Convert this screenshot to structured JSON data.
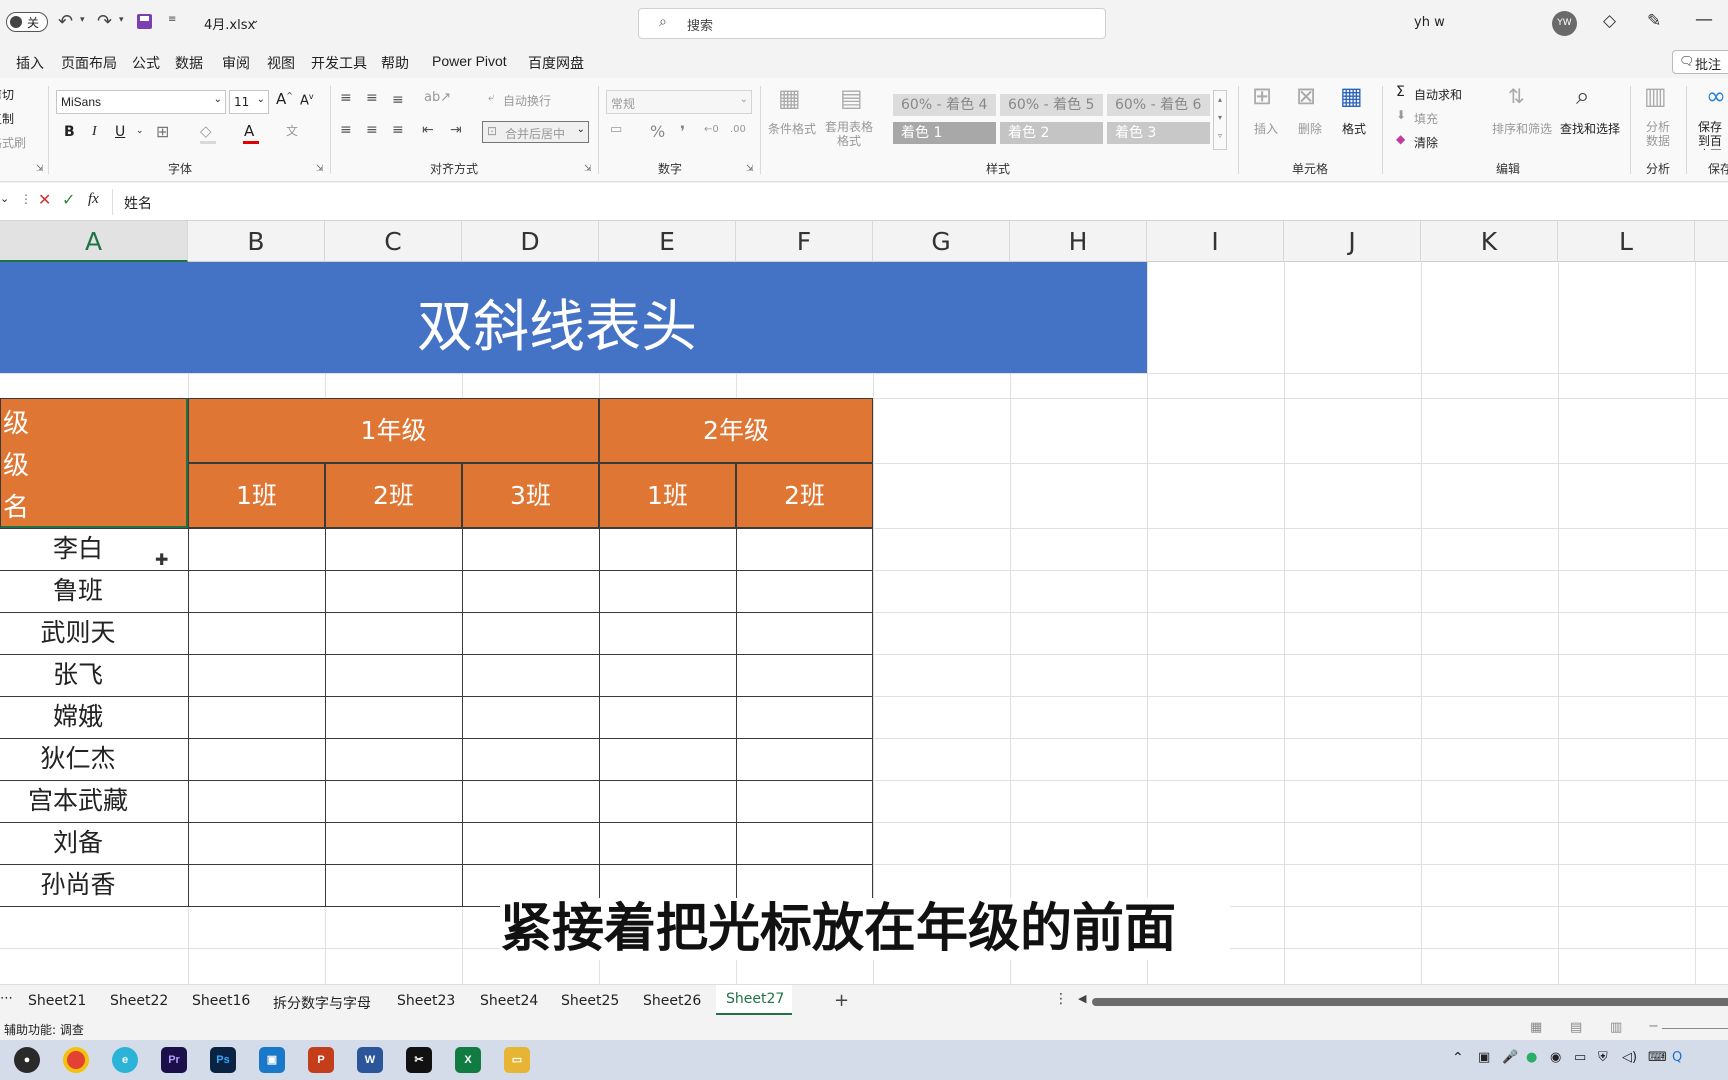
{
  "titlebar": {
    "autosave_label": "关",
    "filename": "4月.xlsx",
    "search_placeholder": "搜索",
    "user_name": "yh w",
    "user_initials": "YW"
  },
  "menu": [
    "插入",
    "页面布局",
    "公式",
    "数据",
    "审阅",
    "视图",
    "开发工具",
    "帮助",
    "Power Pivot",
    "百度网盘"
  ],
  "comments_button": "批注",
  "ribbon": {
    "clipboard": {
      "cut": "剪切",
      "copy": "复制",
      "format_painter": "格式刷"
    },
    "font": {
      "name": "MiSans",
      "size": "11",
      "label": "字体",
      "bold": "B",
      "italic": "I",
      "underline": "U",
      "font_color": "A"
    },
    "alignment": {
      "wrap": "自动换行",
      "merge": "合并后居中",
      "label": "对齐方式"
    },
    "number": {
      "format": "常规",
      "label": "数字",
      "percent": "%"
    },
    "styles": {
      "conditional": "条件格式",
      "table_format": "套用表格格式",
      "label": "样式",
      "boxes": [
        "60% - 着色 4",
        "60% - 着色 5",
        "60% - 着色 6",
        "着色 1",
        "着色 2",
        "着色 3"
      ]
    },
    "cells": {
      "insert": "插入",
      "delete": "删除",
      "format": "格式",
      "label": "单元格"
    },
    "editing": {
      "autosum": "自动求和",
      "fill": "填充",
      "clear": "清除",
      "sort": "排序和筛选",
      "find": "查找和选择",
      "label": "编辑"
    },
    "analysis": {
      "analyze": "分析数据",
      "label": "分析"
    },
    "save": {
      "save": "保存到百度网盘",
      "label": "保存"
    }
  },
  "formula_bar": {
    "fx": "fx",
    "content": "姓名"
  },
  "columns": [
    "A",
    "B",
    "C",
    "D",
    "E",
    "F",
    "G",
    "H",
    "I",
    "J",
    "K",
    "L"
  ],
  "sheet": {
    "title": "双斜线表头",
    "header_a": [
      "级",
      "级",
      "名"
    ],
    "grades": [
      "1年级",
      "2年级"
    ],
    "classes": [
      "1班",
      "2班",
      "3班",
      "1班",
      "2班"
    ],
    "names": [
      "李白",
      "鲁班",
      "武则天",
      "张飞",
      "嫦娥",
      "狄仁杰",
      "宫本武藏",
      "刘备",
      "孙尚香"
    ]
  },
  "subtitle": "紧接着把光标放在年级的前面",
  "sheet_tabs": [
    "Sheet21",
    "Sheet22",
    "Sheet16",
    "拆分数字与字母",
    "Sheet23",
    "Sheet24",
    "Sheet25",
    "Sheet26",
    "Sheet27"
  ],
  "active_tab": "Sheet27",
  "status": "辅助功能: 调查",
  "colors": {
    "title_fill": "#4472c4",
    "header_fill": "#e07633",
    "excel_green": "#217346"
  }
}
